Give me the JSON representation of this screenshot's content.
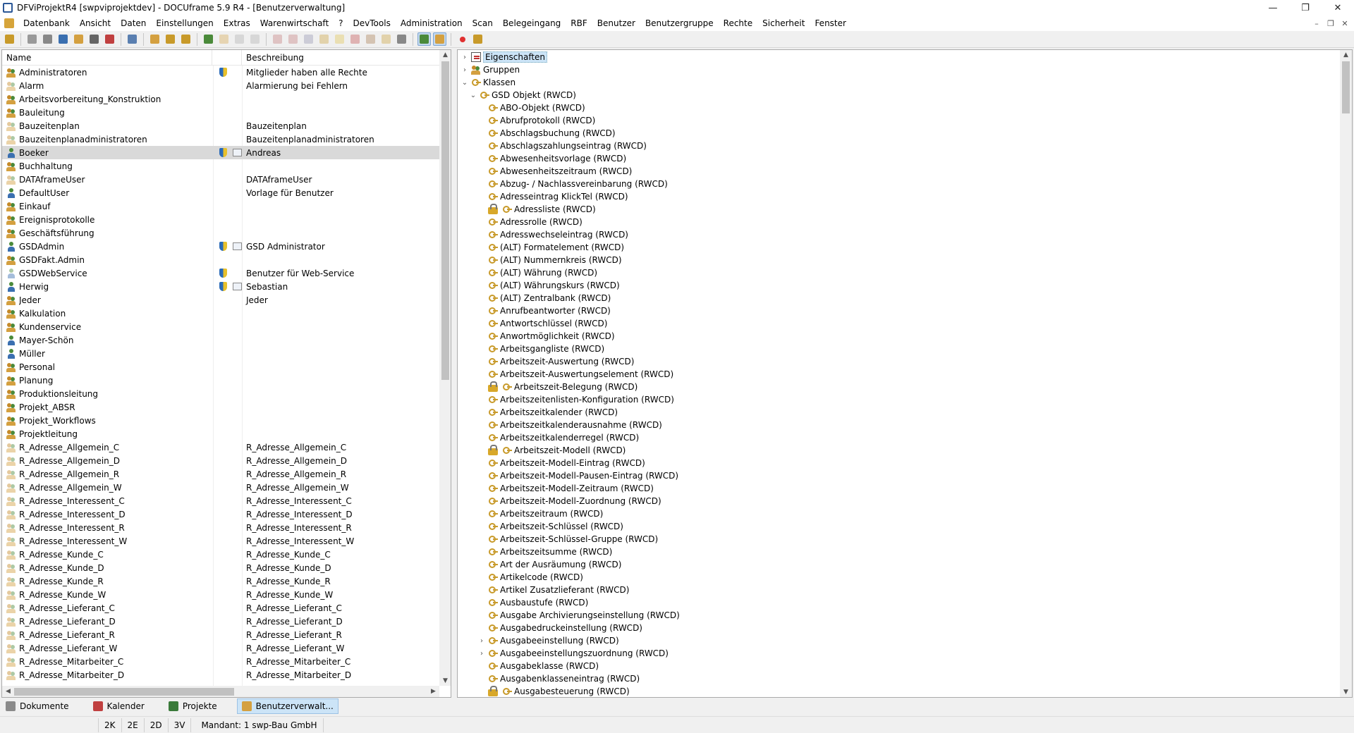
{
  "window": {
    "title": "DFViProjektR4 [swpviprojektdev] - DOCUframe 5.9 R4 - [Benutzerverwaltung]"
  },
  "menu": [
    "Datenbank",
    "Ansicht",
    "Daten",
    "Einstellungen",
    "Extras",
    "Warenwirtschaft",
    "?",
    "DevTools",
    "Administration",
    "Scan",
    "Belegeingang",
    "RBF",
    "Benutzer",
    "Benutzergruppe",
    "Rechte",
    "Sicherheit",
    "Fenster"
  ],
  "toolbar_icons": [
    "open-icon",
    "print-icon",
    "window-icon",
    "list-icon",
    "note-icon",
    "attach-icon",
    "calendar-icon",
    "phone-icon",
    "new-doc-icon",
    "import-icon",
    "export-icon",
    "user-icon",
    "group-icon",
    "user-edit-icon",
    "delete-icon",
    "tool-icon",
    "tool2-icon",
    "link-icon",
    "pen-icon",
    "star-icon",
    "cut-icon",
    "edit-icon",
    "pencil-icon",
    "grid-icon",
    "user-view-icon",
    "group-view-icon",
    "record-icon",
    "flash-icon"
  ],
  "colors": {
    "accent": "#cce4f7",
    "selected_row": "#d9d9d9",
    "tree_highlight": "#cce4f7"
  },
  "users_list": {
    "col_name": "Name",
    "col_desc": "Beschreibung",
    "rows": [
      {
        "name": "Administratoren",
        "desc": "Mitglieder haben alle Rechte",
        "type": "group",
        "shield": true,
        "card": false,
        "inactive": false
      },
      {
        "name": "Alarm",
        "desc": "Alarmierung bei Fehlern",
        "type": "group",
        "shield": false,
        "card": false,
        "inactive": true
      },
      {
        "name": "Arbeitsvorbereitung_Konstruktion",
        "desc": "",
        "type": "group",
        "shield": false,
        "card": false,
        "inactive": false
      },
      {
        "name": "Bauleitung",
        "desc": "",
        "type": "group",
        "shield": false,
        "card": false,
        "inactive": false
      },
      {
        "name": "Bauzeitenplan",
        "desc": "Bauzeitenplan",
        "type": "group",
        "shield": false,
        "card": false,
        "inactive": true
      },
      {
        "name": "Bauzeitenplanadministratoren",
        "desc": "Bauzeitenplanadministratoren",
        "type": "group",
        "shield": false,
        "card": false,
        "inactive": true
      },
      {
        "name": "Boeker",
        "desc": "Andreas",
        "type": "user",
        "shield": true,
        "card": true,
        "inactive": false,
        "selected": true
      },
      {
        "name": "Buchhaltung",
        "desc": "",
        "type": "group",
        "shield": false,
        "card": false,
        "inactive": false
      },
      {
        "name": "DATAframeUser",
        "desc": "DATAframeUser",
        "type": "group",
        "shield": false,
        "card": false,
        "inactive": true
      },
      {
        "name": "DefaultUser",
        "desc": "Vorlage für Benutzer",
        "type": "user",
        "shield": false,
        "card": false,
        "inactive": false
      },
      {
        "name": "Einkauf",
        "desc": "",
        "type": "group",
        "shield": false,
        "card": false,
        "inactive": false
      },
      {
        "name": "Ereignisprotokolle",
        "desc": "",
        "type": "group",
        "shield": false,
        "card": false,
        "inactive": false
      },
      {
        "name": "Geschäftsführung",
        "desc": "",
        "type": "group",
        "shield": false,
        "card": false,
        "inactive": false
      },
      {
        "name": "GSDAdmin",
        "desc": "GSD Administrator",
        "type": "user",
        "shield": true,
        "card": true,
        "inactive": false
      },
      {
        "name": "GSDFakt.Admin",
        "desc": "",
        "type": "group",
        "shield": false,
        "card": false,
        "inactive": false
      },
      {
        "name": "GSDWebService",
        "desc": "Benutzer für Web-Service",
        "type": "user",
        "shield": true,
        "card": false,
        "inactive": true
      },
      {
        "name": "Herwig",
        "desc": "Sebastian",
        "type": "user",
        "shield": true,
        "card": true,
        "inactive": false
      },
      {
        "name": "Jeder",
        "desc": "Jeder",
        "type": "group",
        "shield": false,
        "card": false,
        "inactive": false
      },
      {
        "name": "Kalkulation",
        "desc": "",
        "type": "group",
        "shield": false,
        "card": false,
        "inactive": false
      },
      {
        "name": "Kundenservice",
        "desc": "",
        "type": "group",
        "shield": false,
        "card": false,
        "inactive": false
      },
      {
        "name": "Mayer-Schön",
        "desc": "",
        "type": "user",
        "shield": false,
        "card": false,
        "inactive": false
      },
      {
        "name": "Müller",
        "desc": "",
        "type": "user",
        "shield": false,
        "card": false,
        "inactive": false
      },
      {
        "name": "Personal",
        "desc": "",
        "type": "group",
        "shield": false,
        "card": false,
        "inactive": false
      },
      {
        "name": "Planung",
        "desc": "",
        "type": "group",
        "shield": false,
        "card": false,
        "inactive": false
      },
      {
        "name": "Produktionsleitung",
        "desc": "",
        "type": "group",
        "shield": false,
        "card": false,
        "inactive": false
      },
      {
        "name": "Projekt_ABSR",
        "desc": "",
        "type": "group",
        "shield": false,
        "card": false,
        "inactive": false
      },
      {
        "name": "Projekt_Workflows",
        "desc": "",
        "type": "group",
        "shield": false,
        "card": false,
        "inactive": false
      },
      {
        "name": "Projektleitung",
        "desc": "",
        "type": "group",
        "shield": false,
        "card": false,
        "inactive": false
      },
      {
        "name": "R_Adresse_Allgemein_C",
        "desc": "R_Adresse_Allgemein_C",
        "type": "group",
        "shield": false,
        "card": false,
        "inactive": true
      },
      {
        "name": "R_Adresse_Allgemein_D",
        "desc": "R_Adresse_Allgemein_D",
        "type": "group",
        "shield": false,
        "card": false,
        "inactive": true
      },
      {
        "name": "R_Adresse_Allgemein_R",
        "desc": "R_Adresse_Allgemein_R",
        "type": "group",
        "shield": false,
        "card": false,
        "inactive": true
      },
      {
        "name": "R_Adresse_Allgemein_W",
        "desc": "R_Adresse_Allgemein_W",
        "type": "group",
        "shield": false,
        "card": false,
        "inactive": true
      },
      {
        "name": "R_Adresse_Interessent_C",
        "desc": "R_Adresse_Interessent_C",
        "type": "group",
        "shield": false,
        "card": false,
        "inactive": true
      },
      {
        "name": "R_Adresse_Interessent_D",
        "desc": "R_Adresse_Interessent_D",
        "type": "group",
        "shield": false,
        "card": false,
        "inactive": true
      },
      {
        "name": "R_Adresse_Interessent_R",
        "desc": "R_Adresse_Interessent_R",
        "type": "group",
        "shield": false,
        "card": false,
        "inactive": true
      },
      {
        "name": "R_Adresse_Interessent_W",
        "desc": "R_Adresse_Interessent_W",
        "type": "group",
        "shield": false,
        "card": false,
        "inactive": true
      },
      {
        "name": "R_Adresse_Kunde_C",
        "desc": "R_Adresse_Kunde_C",
        "type": "group",
        "shield": false,
        "card": false,
        "inactive": true
      },
      {
        "name": "R_Adresse_Kunde_D",
        "desc": "R_Adresse_Kunde_D",
        "type": "group",
        "shield": false,
        "card": false,
        "inactive": true
      },
      {
        "name": "R_Adresse_Kunde_R",
        "desc": "R_Adresse_Kunde_R",
        "type": "group",
        "shield": false,
        "card": false,
        "inactive": true
      },
      {
        "name": "R_Adresse_Kunde_W",
        "desc": "R_Adresse_Kunde_W",
        "type": "group",
        "shield": false,
        "card": false,
        "inactive": true
      },
      {
        "name": "R_Adresse_Lieferant_C",
        "desc": "R_Adresse_Lieferant_C",
        "type": "group",
        "shield": false,
        "card": false,
        "inactive": true
      },
      {
        "name": "R_Adresse_Lieferant_D",
        "desc": "R_Adresse_Lieferant_D",
        "type": "group",
        "shield": false,
        "card": false,
        "inactive": true
      },
      {
        "name": "R_Adresse_Lieferant_R",
        "desc": "R_Adresse_Lieferant_R",
        "type": "group",
        "shield": false,
        "card": false,
        "inactive": true
      },
      {
        "name": "R_Adresse_Lieferant_W",
        "desc": "R_Adresse_Lieferant_W",
        "type": "group",
        "shield": false,
        "card": false,
        "inactive": true
      },
      {
        "name": "R_Adresse_Mitarbeiter_C",
        "desc": "R_Adresse_Mitarbeiter_C",
        "type": "group",
        "shield": false,
        "card": false,
        "inactive": true
      },
      {
        "name": "R_Adresse_Mitarbeiter_D",
        "desc": "R_Adresse_Mitarbeiter_D",
        "type": "group",
        "shield": false,
        "card": false,
        "inactive": true
      }
    ]
  },
  "rights_tree": {
    "top": [
      {
        "label": "Eigenschaften",
        "icon": "prop",
        "expand": "›",
        "highlight": true
      },
      {
        "label": "Gruppen",
        "icon": "grp",
        "expand": "›",
        "highlight": false
      },
      {
        "label": "Klassen",
        "icon": "key",
        "expand": "⌄",
        "highlight": false
      }
    ],
    "gsd_object": {
      "label": "GSD Objekt (RWCD)",
      "expand": "⌄"
    },
    "classes": [
      {
        "label": "ABO-Objekt (RWCD)",
        "locked": false,
        "expand": ""
      },
      {
        "label": "Abrufprotokoll (RWCD)",
        "locked": false,
        "expand": ""
      },
      {
        "label": "Abschlagsbuchung (RWCD)",
        "locked": false,
        "expand": ""
      },
      {
        "label": "Abschlagszahlungseintrag (RWCD)",
        "locked": false,
        "expand": ""
      },
      {
        "label": "Abwesenheitsvorlage (RWCD)",
        "locked": false,
        "expand": ""
      },
      {
        "label": "Abwesenheitszeitraum (RWCD)",
        "locked": false,
        "expand": ""
      },
      {
        "label": "Abzug- / Nachlassvereinbarung (RWCD)",
        "locked": false,
        "expand": ""
      },
      {
        "label": "Adresseintrag KlickTel (RWCD)",
        "locked": false,
        "expand": ""
      },
      {
        "label": "Adressliste (RWCD)",
        "locked": true,
        "expand": ""
      },
      {
        "label": "Adressrolle (RWCD)",
        "locked": false,
        "expand": ""
      },
      {
        "label": "Adresswechseleintrag (RWCD)",
        "locked": false,
        "expand": ""
      },
      {
        "label": "(ALT) Formatelement (RWCD)",
        "locked": false,
        "expand": ""
      },
      {
        "label": "(ALT) Nummernkreis (RWCD)",
        "locked": false,
        "expand": ""
      },
      {
        "label": "(ALT) Währung (RWCD)",
        "locked": false,
        "expand": ""
      },
      {
        "label": "(ALT) Währungskurs (RWCD)",
        "locked": false,
        "expand": ""
      },
      {
        "label": "(ALT) Zentralbank (RWCD)",
        "locked": false,
        "expand": ""
      },
      {
        "label": "Anrufbeantworter (RWCD)",
        "locked": false,
        "expand": ""
      },
      {
        "label": "Antwortschlüssel (RWCD)",
        "locked": false,
        "expand": ""
      },
      {
        "label": "Anwortmöglichkeit (RWCD)",
        "locked": false,
        "expand": ""
      },
      {
        "label": "Arbeitsgangliste (RWCD)",
        "locked": false,
        "expand": ""
      },
      {
        "label": "Arbeitszeit-Auswertung (RWCD)",
        "locked": false,
        "expand": ""
      },
      {
        "label": "Arbeitszeit-Auswertungselement (RWCD)",
        "locked": false,
        "expand": ""
      },
      {
        "label": "Arbeitszeit-Belegung (RWCD)",
        "locked": true,
        "expand": ""
      },
      {
        "label": "Arbeitszeitenlisten-Konfiguration (RWCD)",
        "locked": false,
        "expand": ""
      },
      {
        "label": "Arbeitszeitkalender (RWCD)",
        "locked": false,
        "expand": ""
      },
      {
        "label": "Arbeitszeitkalenderausnahme (RWCD)",
        "locked": false,
        "expand": ""
      },
      {
        "label": "Arbeitszeitkalenderregel (RWCD)",
        "locked": false,
        "expand": ""
      },
      {
        "label": "Arbeitszeit-Modell (RWCD)",
        "locked": true,
        "expand": ""
      },
      {
        "label": "Arbeitszeit-Modell-Eintrag (RWCD)",
        "locked": false,
        "expand": ""
      },
      {
        "label": "Arbeitszeit-Modell-Pausen-Eintrag (RWCD)",
        "locked": false,
        "expand": ""
      },
      {
        "label": "Arbeitszeit-Modell-Zeitraum (RWCD)",
        "locked": false,
        "expand": ""
      },
      {
        "label": "Arbeitszeit-Modell-Zuordnung (RWCD)",
        "locked": false,
        "expand": ""
      },
      {
        "label": "Arbeitszeitraum (RWCD)",
        "locked": false,
        "expand": ""
      },
      {
        "label": "Arbeitszeit-Schlüssel (RWCD)",
        "locked": false,
        "expand": ""
      },
      {
        "label": "Arbeitszeit-Schlüssel-Gruppe (RWCD)",
        "locked": false,
        "expand": ""
      },
      {
        "label": "Arbeitszeitsumme (RWCD)",
        "locked": false,
        "expand": ""
      },
      {
        "label": "Art der Ausräumung (RWCD)",
        "locked": false,
        "expand": ""
      },
      {
        "label": "Artikelcode (RWCD)",
        "locked": false,
        "expand": ""
      },
      {
        "label": "Artikel Zusatzlieferant (RWCD)",
        "locked": false,
        "expand": ""
      },
      {
        "label": "Ausbaustufe (RWCD)",
        "locked": false,
        "expand": ""
      },
      {
        "label": "Ausgabe Archivierungseinstellung (RWCD)",
        "locked": false,
        "expand": ""
      },
      {
        "label": "Ausgabedruckeinstellung (RWCD)",
        "locked": false,
        "expand": ""
      },
      {
        "label": "Ausgabeeinstellung (RWCD)",
        "locked": false,
        "expand": "›"
      },
      {
        "label": "Ausgabeeinstellungszuordnung (RWCD)",
        "locked": false,
        "expand": "›"
      },
      {
        "label": "Ausgabeklasse (RWCD)",
        "locked": false,
        "expand": ""
      },
      {
        "label": "Ausgabenklasseneintrag (RWCD)",
        "locked": false,
        "expand": ""
      },
      {
        "label": "Ausgabesteuerung (RWCD)",
        "locked": true,
        "expand": ""
      }
    ]
  },
  "tabs": [
    {
      "label": "Dokumente",
      "active": false,
      "color": "#8a8a8a"
    },
    {
      "label": "Kalender",
      "active": false,
      "color": "#c04040"
    },
    {
      "label": "Projekte",
      "active": false,
      "color": "#3a7a3a"
    },
    {
      "label": "Benutzerverwalt...",
      "active": true,
      "color": "#d4a040"
    }
  ],
  "status": {
    "k2": "2K",
    "e2": "2E",
    "d2": "2D",
    "v3": "3V",
    "mandant": "Mandant: 1 swp-Bau GmbH"
  }
}
